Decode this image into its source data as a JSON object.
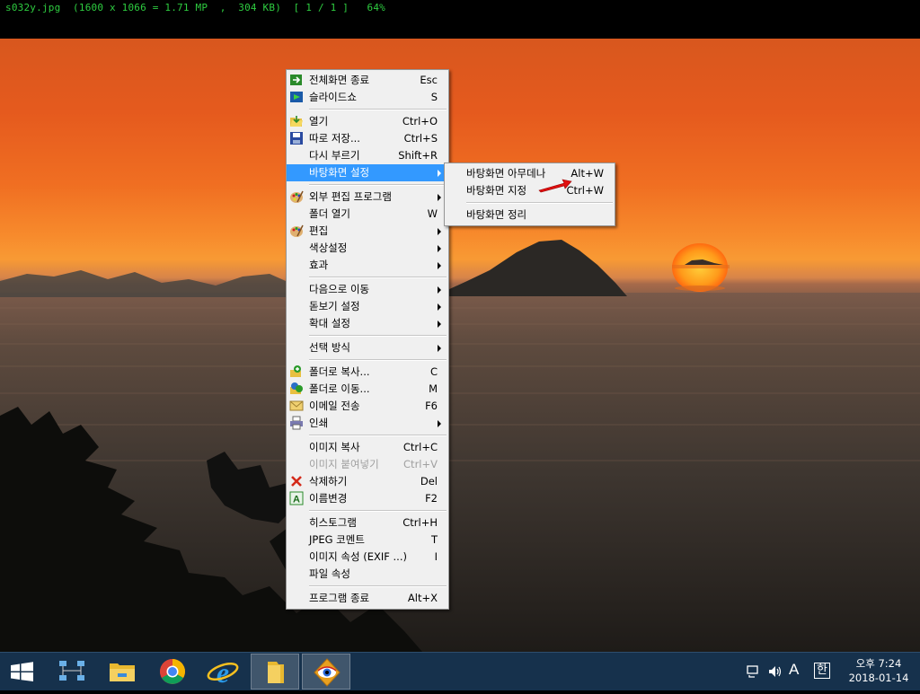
{
  "infobar": {
    "text": "s032y.jpg  (1600 x 1066 = 1.71 MP  ,  304 KB)  [ 1 / 1 ]   64%"
  },
  "menu": {
    "items": [
      {
        "label": "전체화면 종료",
        "shortcut": "Esc",
        "icon": "exit-fullscreen-icon"
      },
      {
        "label": "슬라이드쇼",
        "shortcut": "S",
        "icon": "slideshow-icon"
      },
      {
        "label": "열기",
        "shortcut": "Ctrl+O",
        "icon": "open-folder-icon"
      },
      {
        "label": "따로 저장...",
        "shortcut": "Ctrl+S",
        "icon": "save-disk-icon"
      },
      {
        "label": "다시 부르기",
        "shortcut": "Shift+R"
      },
      {
        "label": "바탕화면 설정"
      },
      {
        "label": "외부 편집 프로그램",
        "icon": "palette-icon"
      },
      {
        "label": "폴더 열기",
        "shortcut": "W"
      },
      {
        "label": "편집",
        "icon": "edit-palette-icon"
      },
      {
        "label": "색상설정"
      },
      {
        "label": "효과"
      },
      {
        "label": "다음으로 이동"
      },
      {
        "label": "돋보기 설정"
      },
      {
        "label": "확대 설정"
      },
      {
        "label": "선택 방식"
      },
      {
        "label": "폴더로 복사...",
        "shortcut": "C",
        "icon": "copy-to-folder-icon"
      },
      {
        "label": "폴더로 이동...",
        "shortcut": "M",
        "icon": "move-to-folder-icon"
      },
      {
        "label": "이메일 전송",
        "shortcut": "F6",
        "icon": "email-icon"
      },
      {
        "label": "인쇄",
        "icon": "printer-icon"
      },
      {
        "label": "이미지 복사",
        "shortcut": "Ctrl+C"
      },
      {
        "label": "이미지 붙여넣기",
        "shortcut": "Ctrl+V"
      },
      {
        "label": "삭제하기",
        "shortcut": "Del",
        "icon": "delete-x-icon"
      },
      {
        "label": "이름변경",
        "shortcut": "F2",
        "icon": "rename-icon"
      },
      {
        "label": "히스토그램",
        "shortcut": "Ctrl+H"
      },
      {
        "label": "JPEG 코멘트",
        "shortcut": "T"
      },
      {
        "label": "이미지 속성 (EXIF ...)",
        "shortcut": "I"
      },
      {
        "label": "파일 속성"
      },
      {
        "label": "프로그램 종료",
        "shortcut": "Alt+X"
      }
    ]
  },
  "submenu": {
    "items": [
      {
        "label": "바탕화면 아무데나",
        "shortcut": "Alt+W"
      },
      {
        "label": "바탕화면 지정",
        "shortcut": "Ctrl+W"
      },
      {
        "label": "바탕화면 정리"
      }
    ]
  },
  "taskbar": {
    "apps": [
      "start-windows-icon",
      "network-icon",
      "file-explorer-icon",
      "chrome-icon",
      "internet-explorer-icon",
      "folder-icon",
      "honeyview-eye-icon"
    ],
    "tray": {
      "ime_lang": "A",
      "ime_mode": "한"
    },
    "clock": {
      "time": "오후 7:24",
      "date": "2018-01-14"
    }
  },
  "colors": {
    "selection": "#3399ff",
    "taskbar": "#16314c",
    "info_text": "#2ecc40"
  }
}
